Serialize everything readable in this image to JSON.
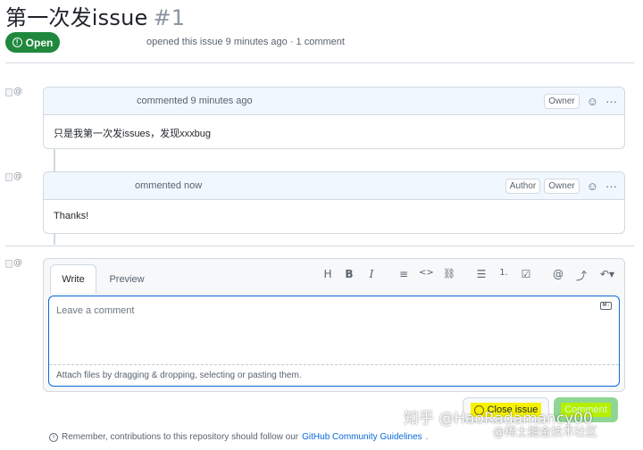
{
  "issue": {
    "title": "第一次发issue",
    "number": "#1",
    "state": "Open",
    "meta": "opened this issue 9 minutes ago · 1 comment"
  },
  "comments": [
    {
      "time_text": "commented 9 minutes ago",
      "badges": [
        "Owner"
      ],
      "body": "只是我第一次发issues，发现xxxbug"
    },
    {
      "time_text": "ommented now",
      "badges": [
        "Author",
        "Owner"
      ],
      "body": "Thanks!"
    }
  ],
  "editor": {
    "tabs": [
      "Write",
      "Preview"
    ],
    "toolbar": [
      "H",
      "B",
      "I",
      "≡",
      "<>",
      "⛓",
      "☰",
      "1.",
      "☑",
      "@",
      "⤴",
      "↶▾"
    ],
    "placeholder": "Leave a comment",
    "attach_text": "Attach files by dragging & dropping, selecting or pasting them.",
    "markdown_icon": "markdown-icon"
  },
  "buttons": {
    "close_issue": "Close issue",
    "comment": "Comment"
  },
  "footer": {
    "text": "Remember, contributions to this repository should follow our",
    "link": "GitHub Community Guidelines",
    "end": "."
  },
  "watermark": {
    "line1": "知乎 @HaoRadamancy00",
    "line2": "@稀土掘金技术社区"
  },
  "colors": {
    "open_green": "#1f883d",
    "link_blue": "#0969da",
    "highlight_yellow": "#f7f300"
  }
}
